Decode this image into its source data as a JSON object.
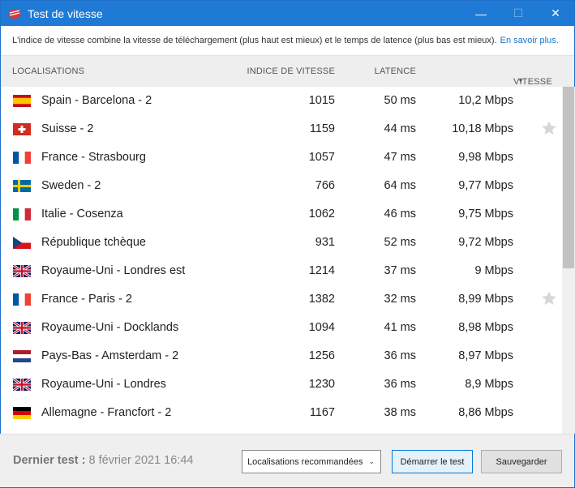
{
  "window": {
    "title": "Test de vitesse",
    "minimize": "—",
    "maximize": "☐",
    "close": "✕"
  },
  "info": {
    "text": "L'indice de vitesse combine la vitesse de téléchargement (plus haut est mieux) et le temps de latence (plus bas est mieux).",
    "link": "En savoir plus."
  },
  "columns": {
    "location": "LOCALISATIONS",
    "index": "INDICE DE VITESSE",
    "latency": "LATENCE",
    "speed": "VITESSE"
  },
  "rows": [
    {
      "flag": "es",
      "name": "Spain - Barcelona - 2",
      "index": "1015",
      "latency": "50 ms",
      "speed": "10,2 Mbps",
      "starred": false
    },
    {
      "flag": "ch",
      "name": "Suisse - 2",
      "index": "1159",
      "latency": "44 ms",
      "speed": "10,18 Mbps",
      "starred": true
    },
    {
      "flag": "fr",
      "name": "France - Strasbourg",
      "index": "1057",
      "latency": "47 ms",
      "speed": "9,98 Mbps",
      "starred": false
    },
    {
      "flag": "se",
      "name": "Sweden - 2",
      "index": "766",
      "latency": "64 ms",
      "speed": "9,77 Mbps",
      "starred": false
    },
    {
      "flag": "it",
      "name": "Italie - Cosenza",
      "index": "1062",
      "latency": "46 ms",
      "speed": "9,75 Mbps",
      "starred": false
    },
    {
      "flag": "cz",
      "name": "République tchèque",
      "index": "931",
      "latency": "52 ms",
      "speed": "9,72 Mbps",
      "starred": false
    },
    {
      "flag": "gb",
      "name": "Royaume-Uni - Londres est",
      "index": "1214",
      "latency": "37 ms",
      "speed": "9 Mbps",
      "starred": false
    },
    {
      "flag": "fr",
      "name": "France - Paris - 2",
      "index": "1382",
      "latency": "32 ms",
      "speed": "8,99 Mbps",
      "starred": true
    },
    {
      "flag": "gb",
      "name": "Royaume-Uni - Docklands",
      "index": "1094",
      "latency": "41 ms",
      "speed": "8,98 Mbps",
      "starred": false
    },
    {
      "flag": "nl",
      "name": "Pays-Bas - Amsterdam - 2",
      "index": "1256",
      "latency": "36 ms",
      "speed": "8,97 Mbps",
      "starred": false
    },
    {
      "flag": "gb",
      "name": "Royaume-Uni - Londres",
      "index": "1230",
      "latency": "36 ms",
      "speed": "8,9 Mbps",
      "starred": false
    },
    {
      "flag": "de",
      "name": "Allemagne - Francfort - 2",
      "index": "1167",
      "latency": "38 ms",
      "speed": "8,86 Mbps",
      "starred": false
    }
  ],
  "footer": {
    "last_test_label": "Dernier test :",
    "last_test_value": "8 février 2021 16:44",
    "select_value": "Localisations recommandées",
    "start_button": "Démarrer le test",
    "save_button": "Sauvegarder"
  },
  "colors": {
    "titlebar": "#1f7ad6",
    "link": "#1a73c9",
    "star": "#d6d6d6",
    "brand": "#da3940"
  }
}
